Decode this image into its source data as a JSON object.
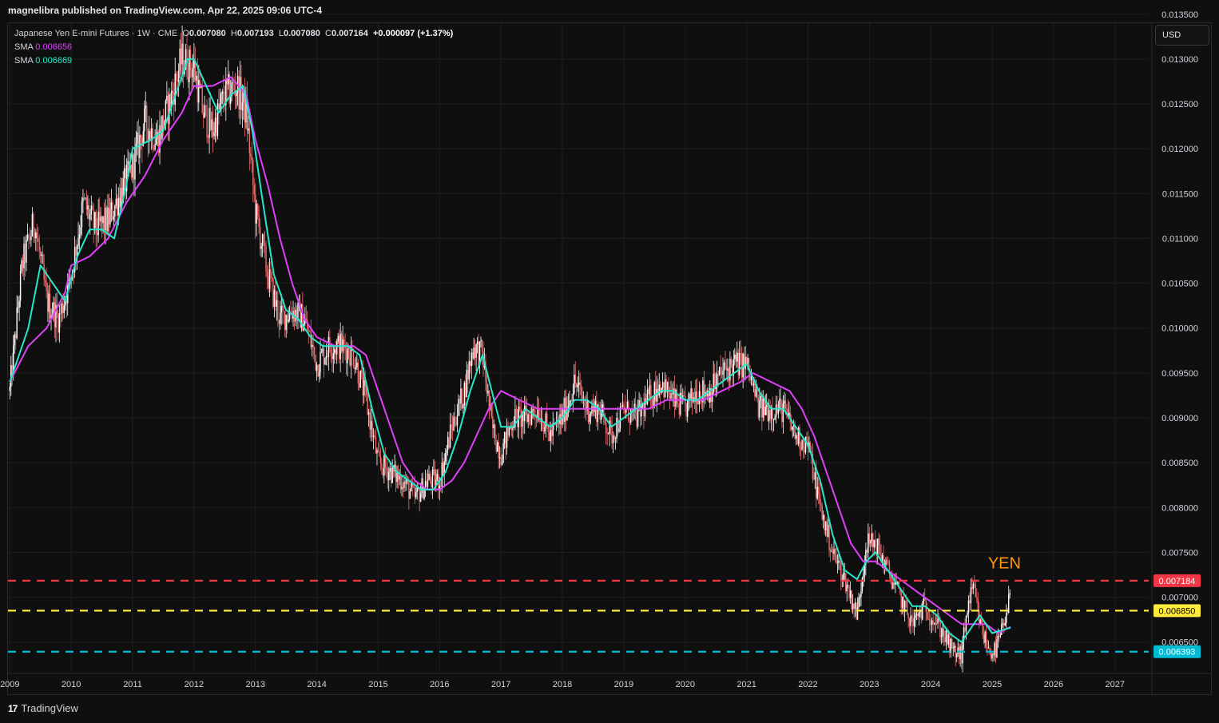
{
  "header": {
    "published": "magnelibra published on TradingView.com, Apr 22, 2025 09:06 UTC-4"
  },
  "legend": {
    "symbol": "Japanese Yen E-mini Futures · 1W · CME",
    "o_label": "O",
    "o": "0.007080",
    "h_label": "H",
    "h": "0.007193",
    "l_label": "L",
    "l": "0.007080",
    "c_label": "C",
    "c": "0.007164",
    "change": "+0.000097 (+1.37%)",
    "sma1_label": "SMA",
    "sma1_value": "0.006656",
    "sma2_label": "SMA",
    "sma2_value": "0.006669"
  },
  "currency_button": "USD",
  "footer": {
    "brand": "TradingView",
    "logo": "17"
  },
  "colors": {
    "background": "#0f0f0f",
    "grid": "#1f1f1f",
    "candle_up": "#ffffff",
    "candle_down": "#f26b6b",
    "sma_slow": "#e040fb",
    "sma_fast": "#26e7c9",
    "line_red": "#f23645",
    "line_yellow": "#ffeb3b",
    "line_cyan": "#00bcd4",
    "annotation": "#ff9800"
  },
  "chart_data": {
    "type": "candlestick",
    "ylim": [
      0.00615,
      0.0134
    ],
    "xlim": [
      2008.97,
      2027.55
    ],
    "y_ticks": [
      "0.006500",
      "0.007000",
      "0.007500",
      "0.008000",
      "0.008500",
      "0.009000",
      "0.009500",
      "0.010000",
      "0.010500",
      "0.011000",
      "0.011500",
      "0.012000",
      "0.012500",
      "0.013000",
      "0.013500"
    ],
    "x_ticks": [
      "2009",
      "2010",
      "2011",
      "2012",
      "2013",
      "2014",
      "2015",
      "2016",
      "2017",
      "2018",
      "2019",
      "2020",
      "2021",
      "2022",
      "2023",
      "2024",
      "2025",
      "2026",
      "2027"
    ],
    "price_path": [
      [
        2009.0,
        0.0093
      ],
      [
        2009.2,
        0.0107
      ],
      [
        2009.4,
        0.0112
      ],
      [
        2009.6,
        0.0103
      ],
      [
        2009.8,
        0.0101
      ],
      [
        2010.0,
        0.0106
      ],
      [
        2010.2,
        0.0114
      ],
      [
        2010.4,
        0.0111
      ],
      [
        2010.6,
        0.0112
      ],
      [
        2010.8,
        0.0115
      ],
      [
        2011.0,
        0.0118
      ],
      [
        2011.2,
        0.0123
      ],
      [
        2011.4,
        0.0121
      ],
      [
        2011.6,
        0.0125
      ],
      [
        2011.8,
        0.013
      ],
      [
        2012.0,
        0.0129
      ],
      [
        2012.15,
        0.0124
      ],
      [
        2012.3,
        0.0122
      ],
      [
        2012.5,
        0.0126
      ],
      [
        2012.7,
        0.0127
      ],
      [
        2012.85,
        0.0124
      ],
      [
        2013.0,
        0.0113
      ],
      [
        2013.2,
        0.0106
      ],
      [
        2013.4,
        0.0101
      ],
      [
        2013.6,
        0.0102
      ],
      [
        2013.8,
        0.0101
      ],
      [
        2014.0,
        0.0096
      ],
      [
        2014.2,
        0.0098
      ],
      [
        2014.4,
        0.0098
      ],
      [
        2014.6,
        0.0097
      ],
      [
        2014.8,
        0.0092
      ],
      [
        2015.0,
        0.0085
      ],
      [
        2015.2,
        0.0084
      ],
      [
        2015.4,
        0.0083
      ],
      [
        2015.6,
        0.0081
      ],
      [
        2015.8,
        0.0083
      ],
      [
        2016.0,
        0.0083
      ],
      [
        2016.2,
        0.0089
      ],
      [
        2016.4,
        0.0093
      ],
      [
        2016.55,
        0.0098
      ],
      [
        2016.7,
        0.0097
      ],
      [
        2016.85,
        0.0089
      ],
      [
        2017.0,
        0.0086
      ],
      [
        2017.2,
        0.009
      ],
      [
        2017.4,
        0.009
      ],
      [
        2017.6,
        0.0091
      ],
      [
        2017.8,
        0.0088
      ],
      [
        2018.0,
        0.009
      ],
      [
        2018.2,
        0.0094
      ],
      [
        2018.4,
        0.0091
      ],
      [
        2018.6,
        0.0091
      ],
      [
        2018.8,
        0.0088
      ],
      [
        2019.0,
        0.0091
      ],
      [
        2019.2,
        0.009
      ],
      [
        2019.4,
        0.0092
      ],
      [
        2019.6,
        0.0094
      ],
      [
        2019.8,
        0.0092
      ],
      [
        2020.0,
        0.0091
      ],
      [
        2020.2,
        0.0093
      ],
      [
        2020.4,
        0.0093
      ],
      [
        2020.6,
        0.0095
      ],
      [
        2020.8,
        0.0096
      ],
      [
        2021.0,
        0.0096
      ],
      [
        2021.2,
        0.0091
      ],
      [
        2021.4,
        0.0091
      ],
      [
        2021.6,
        0.0091
      ],
      [
        2021.8,
        0.0088
      ],
      [
        2022.0,
        0.0087
      ],
      [
        2022.2,
        0.008
      ],
      [
        2022.4,
        0.0075
      ],
      [
        2022.6,
        0.0072
      ],
      [
        2022.8,
        0.0068
      ],
      [
        2022.95,
        0.0076
      ],
      [
        2023.1,
        0.0076
      ],
      [
        2023.3,
        0.0073
      ],
      [
        2023.5,
        0.007
      ],
      [
        2023.7,
        0.0067
      ],
      [
        2023.9,
        0.0069
      ],
      [
        2024.0,
        0.0068
      ],
      [
        2024.2,
        0.0066
      ],
      [
        2024.35,
        0.0064
      ],
      [
        2024.5,
        0.00635
      ],
      [
        2024.6,
        0.0069
      ],
      [
        2024.7,
        0.0071
      ],
      [
        2024.8,
        0.0067
      ],
      [
        2024.95,
        0.0064
      ],
      [
        2025.05,
        0.0064
      ],
      [
        2025.15,
        0.0066
      ],
      [
        2025.25,
        0.0068
      ],
      [
        2025.3,
        0.00716
      ]
    ],
    "sma_slow_path": [
      [
        2009.0,
        0.0094
      ],
      [
        2009.3,
        0.0098
      ],
      [
        2009.6,
        0.01
      ],
      [
        2009.9,
        0.0104
      ],
      [
        2010.0,
        0.0107
      ],
      [
        2010.3,
        0.0108
      ],
      [
        2010.6,
        0.011
      ],
      [
        2010.9,
        0.0114
      ],
      [
        2011.2,
        0.0117
      ],
      [
        2011.5,
        0.0121
      ],
      [
        2011.8,
        0.0124
      ],
      [
        2012.0,
        0.0127
      ],
      [
        2012.3,
        0.0127
      ],
      [
        2012.6,
        0.0128
      ],
      [
        2012.85,
        0.0126
      ],
      [
        2013.0,
        0.0121
      ],
      [
        2013.2,
        0.0116
      ],
      [
        2013.4,
        0.011
      ],
      [
        2013.6,
        0.0105
      ],
      [
        2013.8,
        0.0101
      ],
      [
        2014.0,
        0.0099
      ],
      [
        2014.3,
        0.0098
      ],
      [
        2014.6,
        0.0098
      ],
      [
        2014.8,
        0.0097
      ],
      [
        2015.0,
        0.0093
      ],
      [
        2015.2,
        0.0089
      ],
      [
        2015.4,
        0.0085
      ],
      [
        2015.6,
        0.0083
      ],
      [
        2015.8,
        0.0082
      ],
      [
        2016.0,
        0.0082
      ],
      [
        2016.2,
        0.0083
      ],
      [
        2016.4,
        0.0085
      ],
      [
        2016.6,
        0.0088
      ],
      [
        2016.8,
        0.0091
      ],
      [
        2017.0,
        0.0093
      ],
      [
        2017.3,
        0.0092
      ],
      [
        2017.6,
        0.0091
      ],
      [
        2017.9,
        0.0091
      ],
      [
        2018.2,
        0.0091
      ],
      [
        2018.5,
        0.0091
      ],
      [
        2018.8,
        0.0091
      ],
      [
        2019.1,
        0.0091
      ],
      [
        2019.4,
        0.0091
      ],
      [
        2019.7,
        0.0092
      ],
      [
        2020.0,
        0.0092
      ],
      [
        2020.3,
        0.0092
      ],
      [
        2020.6,
        0.0093
      ],
      [
        2020.9,
        0.0094
      ],
      [
        2021.1,
        0.0095
      ],
      [
        2021.4,
        0.0094
      ],
      [
        2021.7,
        0.0093
      ],
      [
        2021.9,
        0.0091
      ],
      [
        2022.1,
        0.0088
      ],
      [
        2022.3,
        0.0084
      ],
      [
        2022.5,
        0.008
      ],
      [
        2022.7,
        0.0076
      ],
      [
        2022.9,
        0.0074
      ],
      [
        2023.1,
        0.0074
      ],
      [
        2023.3,
        0.0073
      ],
      [
        2023.5,
        0.0072
      ],
      [
        2023.7,
        0.0071
      ],
      [
        2023.9,
        0.007
      ],
      [
        2024.1,
        0.0069
      ],
      [
        2024.3,
        0.0068
      ],
      [
        2024.5,
        0.0067
      ],
      [
        2024.7,
        0.0067
      ],
      [
        2024.9,
        0.0067
      ],
      [
        2025.1,
        0.0066
      ],
      [
        2025.3,
        0.00667
      ]
    ],
    "sma_fast_path": [
      [
        2009.0,
        0.0094
      ],
      [
        2009.3,
        0.01
      ],
      [
        2009.5,
        0.0107
      ],
      [
        2009.7,
        0.0105
      ],
      [
        2009.9,
        0.0103
      ],
      [
        2010.1,
        0.0108
      ],
      [
        2010.3,
        0.0111
      ],
      [
        2010.5,
        0.0111
      ],
      [
        2010.7,
        0.011
      ],
      [
        2010.9,
        0.0116
      ],
      [
        2011.0,
        0.012
      ],
      [
        2011.3,
        0.0121
      ],
      [
        2011.5,
        0.0122
      ],
      [
        2011.7,
        0.0126
      ],
      [
        2011.9,
        0.013
      ],
      [
        2012.0,
        0.013
      ],
      [
        2012.2,
        0.0127
      ],
      [
        2012.4,
        0.0124
      ],
      [
        2012.6,
        0.0126
      ],
      [
        2012.8,
        0.0127
      ],
      [
        2012.95,
        0.0122
      ],
      [
        2013.1,
        0.0115
      ],
      [
        2013.3,
        0.0106
      ],
      [
        2013.5,
        0.0102
      ],
      [
        2013.7,
        0.0101
      ],
      [
        2013.9,
        0.0099
      ],
      [
        2014.1,
        0.0098
      ],
      [
        2014.3,
        0.0098
      ],
      [
        2014.5,
        0.0098
      ],
      [
        2014.7,
        0.0097
      ],
      [
        2014.9,
        0.0091
      ],
      [
        2015.1,
        0.0086
      ],
      [
        2015.3,
        0.0084
      ],
      [
        2015.5,
        0.0083
      ],
      [
        2015.7,
        0.0082
      ],
      [
        2015.9,
        0.0082
      ],
      [
        2016.1,
        0.0084
      ],
      [
        2016.3,
        0.0088
      ],
      [
        2016.5,
        0.0093
      ],
      [
        2016.7,
        0.0097
      ],
      [
        2016.85,
        0.0093
      ],
      [
        2017.0,
        0.0089
      ],
      [
        2017.2,
        0.0089
      ],
      [
        2017.4,
        0.0091
      ],
      [
        2017.6,
        0.009
      ],
      [
        2017.8,
        0.0089
      ],
      [
        2018.0,
        0.009
      ],
      [
        2018.2,
        0.0092
      ],
      [
        2018.4,
        0.0092
      ],
      [
        2018.6,
        0.0091
      ],
      [
        2018.8,
        0.0089
      ],
      [
        2019.0,
        0.009
      ],
      [
        2019.2,
        0.0091
      ],
      [
        2019.4,
        0.0092
      ],
      [
        2019.6,
        0.0093
      ],
      [
        2019.8,
        0.0093
      ],
      [
        2020.0,
        0.0092
      ],
      [
        2020.2,
        0.0092
      ],
      [
        2020.4,
        0.0093
      ],
      [
        2020.6,
        0.0094
      ],
      [
        2020.8,
        0.0095
      ],
      [
        2021.0,
        0.0096
      ],
      [
        2021.2,
        0.0093
      ],
      [
        2021.4,
        0.0091
      ],
      [
        2021.6,
        0.0091
      ],
      [
        2021.8,
        0.0089
      ],
      [
        2022.0,
        0.0087
      ],
      [
        2022.2,
        0.0083
      ],
      [
        2022.4,
        0.0077
      ],
      [
        2022.6,
        0.0073
      ],
      [
        2022.8,
        0.0072
      ],
      [
        2022.95,
        0.0074
      ],
      [
        2023.1,
        0.0075
      ],
      [
        2023.3,
        0.0073
      ],
      [
        2023.5,
        0.0071
      ],
      [
        2023.7,
        0.0069
      ],
      [
        2023.9,
        0.0069
      ],
      [
        2024.1,
        0.0068
      ],
      [
        2024.3,
        0.0066
      ],
      [
        2024.5,
        0.0065
      ],
      [
        2024.7,
        0.0067
      ],
      [
        2024.8,
        0.0068
      ],
      [
        2025.0,
        0.0066
      ],
      [
        2025.15,
        0.00663
      ],
      [
        2025.3,
        0.00666
      ]
    ],
    "horizontal_lines": [
      {
        "name": "resistance",
        "value": 0.007184,
        "label": "0.007184",
        "color": "#f23645"
      },
      {
        "name": "middle",
        "value": 0.00685,
        "label": "0.006850",
        "color": "#ffeb3b"
      },
      {
        "name": "support",
        "value": 0.006393,
        "label": "0.006393",
        "color": "#00bcd4"
      }
    ],
    "annotation": {
      "text": "YEN",
      "x": 2025.2,
      "y": 0.00732
    },
    "legend_position": "top-left"
  }
}
